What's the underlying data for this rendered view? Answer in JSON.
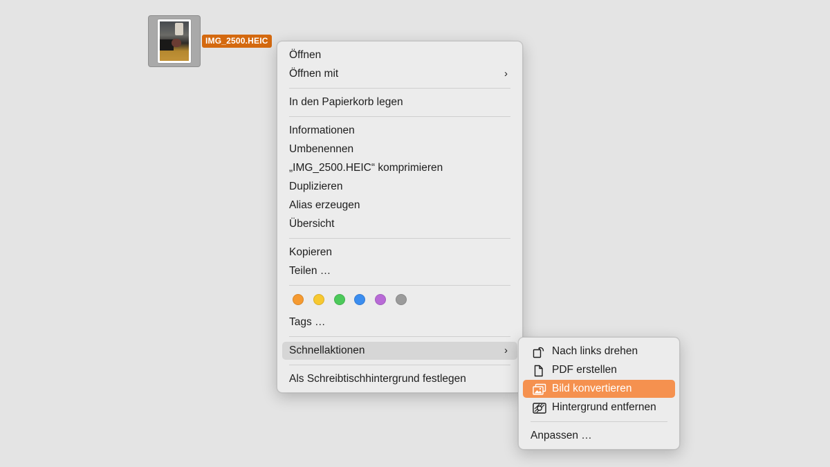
{
  "desktop": {
    "file_name": "IMG_2500.HEIC"
  },
  "context_menu": {
    "items": [
      {
        "label": "Öffnen"
      },
      {
        "label": "Öffnen mit",
        "has_submenu": true
      },
      {
        "label": "In den Papierkorb legen"
      },
      {
        "label": "Informationen"
      },
      {
        "label": "Umbenennen"
      },
      {
        "label": "„IMG_2500.HEIC“ komprimieren"
      },
      {
        "label": "Duplizieren"
      },
      {
        "label": "Alias erzeugen"
      },
      {
        "label": "Übersicht"
      },
      {
        "label": "Kopieren"
      },
      {
        "label": "Teilen …"
      },
      {
        "label": "Tags …"
      },
      {
        "label": "Schnellaktionen",
        "has_submenu": true,
        "state": "highlighted"
      },
      {
        "label": "Als Schreibtischhintergrund festlegen"
      }
    ],
    "chevron": "›",
    "tag_colors": [
      {
        "name": "orange",
        "color": "#f59a30"
      },
      {
        "name": "yellow",
        "color": "#f7c830"
      },
      {
        "name": "green",
        "color": "#4cc95a"
      },
      {
        "name": "blue",
        "color": "#3b8def"
      },
      {
        "name": "purple",
        "color": "#b86ad6"
      },
      {
        "name": "gray",
        "color": "#9b9b9b"
      }
    ]
  },
  "quick_actions_menu": {
    "items": [
      {
        "label": "Nach links drehen",
        "icon": "rotate-left-icon"
      },
      {
        "label": "PDF erstellen",
        "icon": "document-icon"
      },
      {
        "label": "Bild konvertieren",
        "icon": "photos-icon",
        "state": "selected"
      },
      {
        "label": "Hintergrund entfernen",
        "icon": "remove-background-icon"
      },
      {
        "label": "Anpassen …"
      }
    ]
  },
  "colors": {
    "selection": "#f5914f",
    "file_label_bg": "#d4690f"
  }
}
